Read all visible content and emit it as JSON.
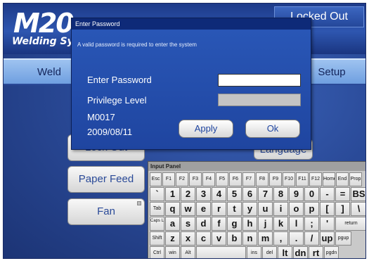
{
  "header": {
    "logo_main": "M20",
    "logo_sub": "Welding Sy",
    "lock_status": "Locked Out"
  },
  "tabs": {
    "weld": "Weld",
    "setup": "Setup"
  },
  "side_buttons": {
    "lock_out": "Lock Out",
    "paper_feed": "Paper Feed",
    "fan": "Fan",
    "language": "Language"
  },
  "dialog": {
    "title": "Enter Password",
    "message": "A valid password is required to enter the system",
    "password_label": "Enter Password",
    "password_value": "",
    "privilege_label": "Privilege Level",
    "privilege_value": "",
    "code": "M0017",
    "date": "2009/08/11",
    "apply_label": "Apply",
    "ok_label": "Ok"
  },
  "input_panel": {
    "title": "Input Panel",
    "rows": [
      [
        "Esc",
        "F1",
        "F2",
        "F3",
        "F4",
        "F5",
        "F6",
        "F7",
        "F8",
        "F9",
        "F10",
        "F11",
        "F12",
        "Home",
        "End",
        "Prop"
      ],
      [
        "`",
        "1",
        "2",
        "3",
        "4",
        "5",
        "6",
        "7",
        "8",
        "9",
        "0",
        "-",
        "=",
        "BS"
      ],
      [
        "Tab",
        "q",
        "w",
        "e",
        "r",
        "t",
        "y",
        "u",
        "i",
        "o",
        "p",
        "[",
        "]",
        "\\"
      ],
      [
        "Caps Lock",
        "a",
        "s",
        "d",
        "f",
        "g",
        "h",
        "j",
        "k",
        "l",
        ";",
        "'",
        "return"
      ],
      [
        "Shift",
        "z",
        "x",
        "c",
        "v",
        "b",
        "n",
        "m",
        ",",
        ".",
        "/",
        "up",
        "pgup"
      ],
      [
        "Ctrl",
        "win",
        "Alt",
        "",
        "ins",
        "del",
        "lt",
        "dn",
        "rt",
        "pgdn"
      ]
    ]
  }
}
